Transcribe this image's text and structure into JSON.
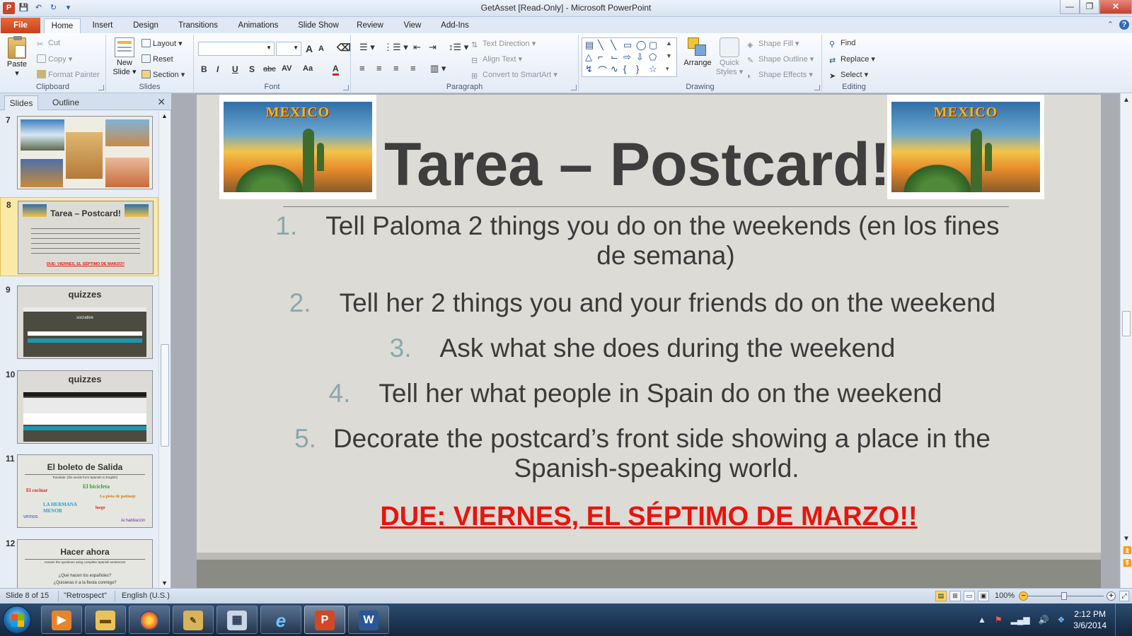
{
  "window": {
    "title": "GetAsset [Read-Only]  -  Microsoft PowerPoint",
    "controls": {
      "minimize": "—",
      "restore": "❐",
      "close": "✕"
    }
  },
  "tabs": [
    "File",
    "Home",
    "Insert",
    "Design",
    "Transitions",
    "Animations",
    "Slide Show",
    "Review",
    "View",
    "Add-Ins"
  ],
  "ribbon": {
    "clipboard": {
      "label": "Clipboard",
      "paste": "Paste",
      "cut": "Cut",
      "copy": "Copy",
      "format_painter": "Format Painter"
    },
    "slides": {
      "label": "Slides",
      "new_slide": "New",
      "new_slide2": "Slide",
      "layout": "Layout",
      "reset": "Reset",
      "section": "Section"
    },
    "font": {
      "label": "Font",
      "bold": "B",
      "italic": "I",
      "underline": "U",
      "shadow": "S",
      "strike": "abc",
      "spacing": "AV",
      "case": "Aa",
      "grow": "A",
      "shrink": "A",
      "color": "A"
    },
    "paragraph": {
      "label": "Paragraph",
      "text_direction": "Text Direction",
      "align_text": "Align Text",
      "smartart": "Convert to SmartArt"
    },
    "drawing": {
      "label": "Drawing",
      "arrange": "Arrange",
      "quick": "Quick",
      "styles": "Styles",
      "shape_fill": "Shape Fill",
      "shape_outline": "Shape Outline",
      "shape_effects": "Shape Effects"
    },
    "editing": {
      "label": "Editing",
      "find": "Find",
      "replace": "Replace",
      "select": "Select"
    }
  },
  "side_panel": {
    "tabs": [
      "Slides",
      "Outline"
    ],
    "thumbnails": [
      {
        "num": "7"
      },
      {
        "num": "8",
        "title": "Tarea – Postcard!",
        "due": "DUE: VIERNES, EL SÉPTIMO DE MARZO!!"
      },
      {
        "num": "9",
        "title": "quizzes",
        "brand": "socrative"
      },
      {
        "num": "10",
        "title": "quizzes"
      },
      {
        "num": "11",
        "title": "El boleto de Salida",
        "sub": "Translate: (the words from Spanish to English)",
        "w1": "El cocinar",
        "w2": "El bicicleta",
        "w3": "LA HERMANA MENOR",
        "w4": "La pista de patinaje",
        "w5": "vemos",
        "w6": "luego",
        "w7": "la habitación"
      },
      {
        "num": "12",
        "title": "Hacer ahora",
        "sub": "Answer the questions using complete Spanish sentences!",
        "q1": "¿Qué hacen los españoles?",
        "q2": "¿Quisieras ir a la fiesta conmigo?"
      }
    ]
  },
  "slide": {
    "title": "Tarea – Postcard!",
    "image_word": "MEXICO",
    "items": [
      {
        "num": "1.",
        "line1": "Tell Paloma 2 things you do on the weekends (en los fines",
        "line2": "de semana)"
      },
      {
        "num": "2.",
        "line1": "Tell her 2 things you and your friends do on the weekend"
      },
      {
        "num": "3.",
        "line1": "Ask what she does during the weekend"
      },
      {
        "num": "4.",
        "line1": "Tell her what people in Spain do on the weekend"
      },
      {
        "num": "5.",
        "line1": "Decorate the postcard’s front side showing a place in the",
        "line2": "Spanish-speaking world."
      }
    ],
    "due": "DUE: VIERNES, EL SÉPTIMO DE MARZO!!"
  },
  "status": {
    "slide": "Slide 8 of 15",
    "theme": "\"Retrospect\"",
    "language": "English (U.S.)",
    "zoom": "100%"
  },
  "taskbar": {
    "time": "2:12 PM",
    "date": "3/6/2014"
  },
  "colors": {
    "due_red": "#e8140d",
    "list_num": "#8aa8ad",
    "file_tab": "#d0501f",
    "slide_bg": "#dcdbd5"
  }
}
